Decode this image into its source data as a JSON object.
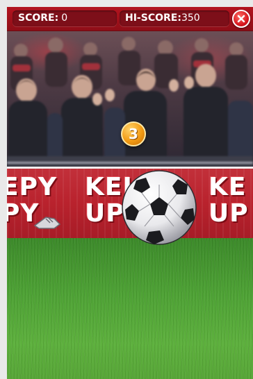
{
  "hud": {
    "score_label": "SCORE:",
    "score_value": "0",
    "hiscore_label": "HI-SCORE:",
    "hiscore_value": "350"
  },
  "counter": "3",
  "banner": {
    "left_text": "EPY\nPY",
    "middle_text": "KEI\nUPI",
    "right_text": "KE\nUP"
  },
  "icons": {
    "close": "close-icon",
    "ball": "soccer-ball-icon"
  },
  "colors": {
    "hud_red": "#b3141f",
    "banner_red": "#b9222d",
    "counter_orange": "#f29a13",
    "pitch_green": "#4ea235"
  }
}
